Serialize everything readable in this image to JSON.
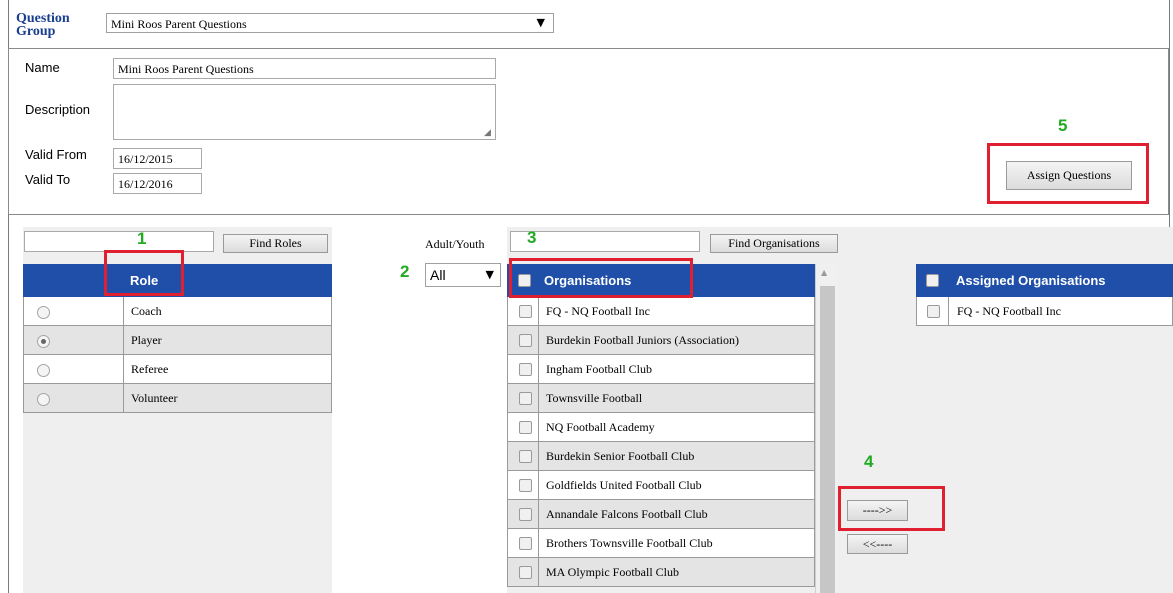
{
  "question_group": {
    "label": "Question Group",
    "selected": "Mini Roos Parent Questions"
  },
  "form": {
    "name_label": "Name",
    "name_value": "Mini Roos Parent Questions",
    "description_label": "Description",
    "description_value": "",
    "valid_from_label": "Valid From",
    "valid_from_value": "16/12/2015",
    "valid_to_label": "Valid To",
    "valid_to_value": "16/12/2016",
    "assign_questions_label": "Assign Questions"
  },
  "roles": {
    "search_value": "",
    "find_button": "Find Roles",
    "header": "Role",
    "items": [
      {
        "label": "Coach",
        "selected": false
      },
      {
        "label": "Player",
        "selected": true
      },
      {
        "label": "Referee",
        "selected": false
      },
      {
        "label": "Volunteer",
        "selected": false
      }
    ]
  },
  "adult_youth": {
    "label": "Adult/Youth",
    "selected": "All"
  },
  "organisations": {
    "search_value": "",
    "find_button": "Find Organisations",
    "header": "Organisations",
    "items": [
      "FQ - NQ Football Inc",
      "Burdekin Football Juniors (Association)",
      "Ingham Football Club",
      "Townsville Football",
      "NQ Football Academy",
      "Burdekin Senior Football Club",
      "Goldfields United Football Club",
      "Annandale Falcons Football Club",
      "Brothers Townsville Football Club",
      "MA Olympic Football Club"
    ]
  },
  "transfer": {
    "add_label": "---->>",
    "remove_label": "<<----"
  },
  "assigned": {
    "header": "Assigned Organisations",
    "items": [
      "FQ - NQ Football Inc"
    ]
  },
  "callouts": [
    "1",
    "2",
    "3",
    "4",
    "5"
  ],
  "colors": {
    "header_blue": "#1f4fa8",
    "callout_red": "#e02030",
    "callout_green": "#22aa22",
    "label_blue": "#1a3f8f"
  }
}
